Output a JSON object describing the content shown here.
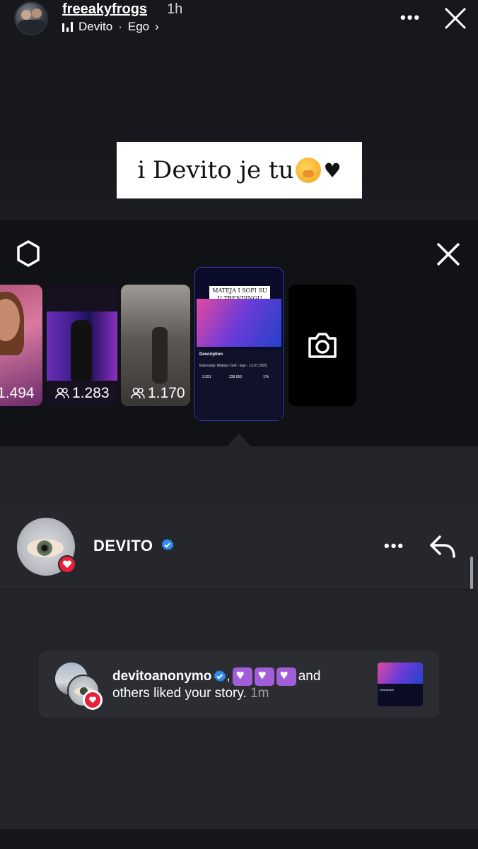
{
  "story": {
    "username": "freeakyfrogs",
    "time_ago": "1h",
    "music": {
      "artist": "Devito",
      "separator": "·",
      "song": "Ego"
    },
    "caption": {
      "text": "i Devito je tu"
    }
  },
  "tray": {
    "items": [
      {
        "views": "1.494"
      },
      {
        "views": "1.283"
      },
      {
        "views": "1.170"
      }
    ],
    "selected": {
      "caption": "MATEJA I SOFI SU U TRENDINGU",
      "panel_title": "Description",
      "panel_text": "Eskovizija: Mateja i Sofi - Ego - 13.07.2025.",
      "stat1": "3.391",
      "stat2": "238.653",
      "stat3": "17k"
    }
  },
  "viewer": {
    "name": "DEVITO"
  },
  "notification": {
    "user": "devitoanonymo",
    "comma": ",",
    "and": "and",
    "line2": "others liked your story.",
    "time": "1m"
  },
  "colors": {
    "verified_blue": "#2d8cf0",
    "like_red": "#e8203a",
    "emoji_purple": "#a25ed8"
  }
}
